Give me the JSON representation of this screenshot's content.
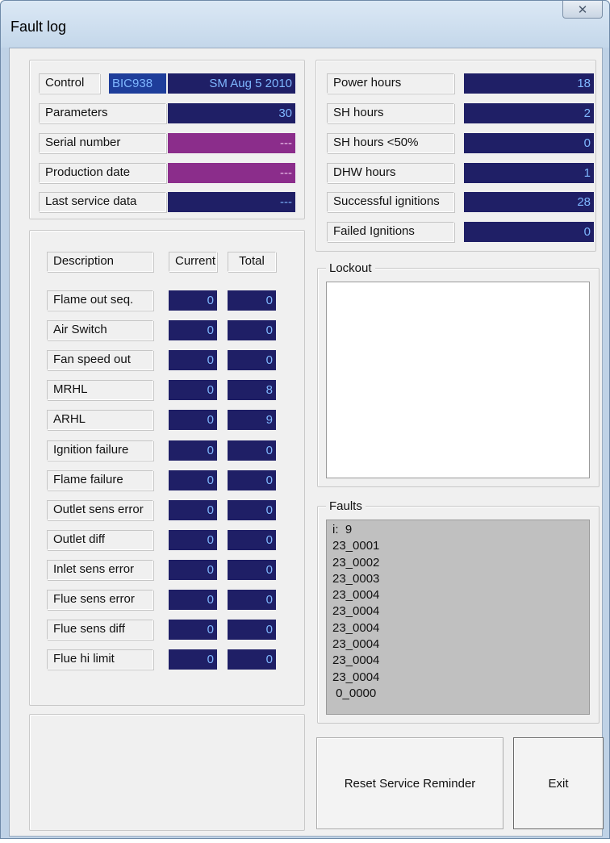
{
  "window": {
    "title": "Fault log",
    "close_icon": "close-x-icon"
  },
  "info": {
    "control_label": "Control",
    "control_code": "BIC938",
    "control_version": "SM Aug  5 2010",
    "rows": [
      {
        "label": "Parameters",
        "value": "30"
      },
      {
        "label": "Serial number",
        "value": "---"
      },
      {
        "label": "Production date",
        "value": "---"
      },
      {
        "label": "Last service data",
        "value": "---"
      }
    ]
  },
  "hours": {
    "rows": [
      {
        "label": "Power hours",
        "value": "18"
      },
      {
        "label": "SH hours",
        "value": "2"
      },
      {
        "label": "SH hours <50%",
        "value": "0"
      },
      {
        "label": "DHW hours",
        "value": "1"
      },
      {
        "label": "Successful ignitions",
        "value": "28"
      },
      {
        "label": "Failed Ignitions",
        "value": "0"
      }
    ]
  },
  "counters": {
    "header_description": "Description",
    "header_current": "Current",
    "header_total": "Total",
    "rows": [
      {
        "label": "Flame out seq.",
        "current": "0",
        "total": "0"
      },
      {
        "label": "Air Switch",
        "current": "0",
        "total": "0"
      },
      {
        "label": "Fan speed out",
        "current": "0",
        "total": "0"
      },
      {
        "label": "MRHL",
        "current": "0",
        "total": "8"
      },
      {
        "label": "ARHL",
        "current": "0",
        "total": "9"
      },
      {
        "label": "Ignition failure",
        "current": "0",
        "total": "0"
      },
      {
        "label": "Flame failure",
        "current": "0",
        "total": "0"
      },
      {
        "label": "Outlet sens error",
        "current": "0",
        "total": "0"
      },
      {
        "label": "Outlet diff",
        "current": "0",
        "total": "0"
      },
      {
        "label": "Inlet sens error",
        "current": "0",
        "total": "0"
      },
      {
        "label": "Flue sens error",
        "current": "0",
        "total": "0"
      },
      {
        "label": "Flue sens diff",
        "current": "0",
        "total": "0"
      },
      {
        "label": "Flue hi limit",
        "current": "0",
        "total": "0"
      }
    ]
  },
  "lockout": {
    "title": "Lockout",
    "content": ""
  },
  "faults": {
    "title": "Faults",
    "lines": [
      "i:  9",
      "23_0001",
      "23_0002",
      "23_0003",
      "23_0004",
      "23_0004",
      "23_0004",
      "23_0004",
      "23_0004",
      "23_0004",
      " 0_0000"
    ]
  },
  "buttons": {
    "reset": "Reset Service Reminder",
    "exit": "Exit"
  },
  "colors": {
    "value_bg": "#1f1f66",
    "value_text": "#7fb7ff",
    "purple_bg": "#8b2d8b",
    "frame": "#bfd2e6"
  }
}
